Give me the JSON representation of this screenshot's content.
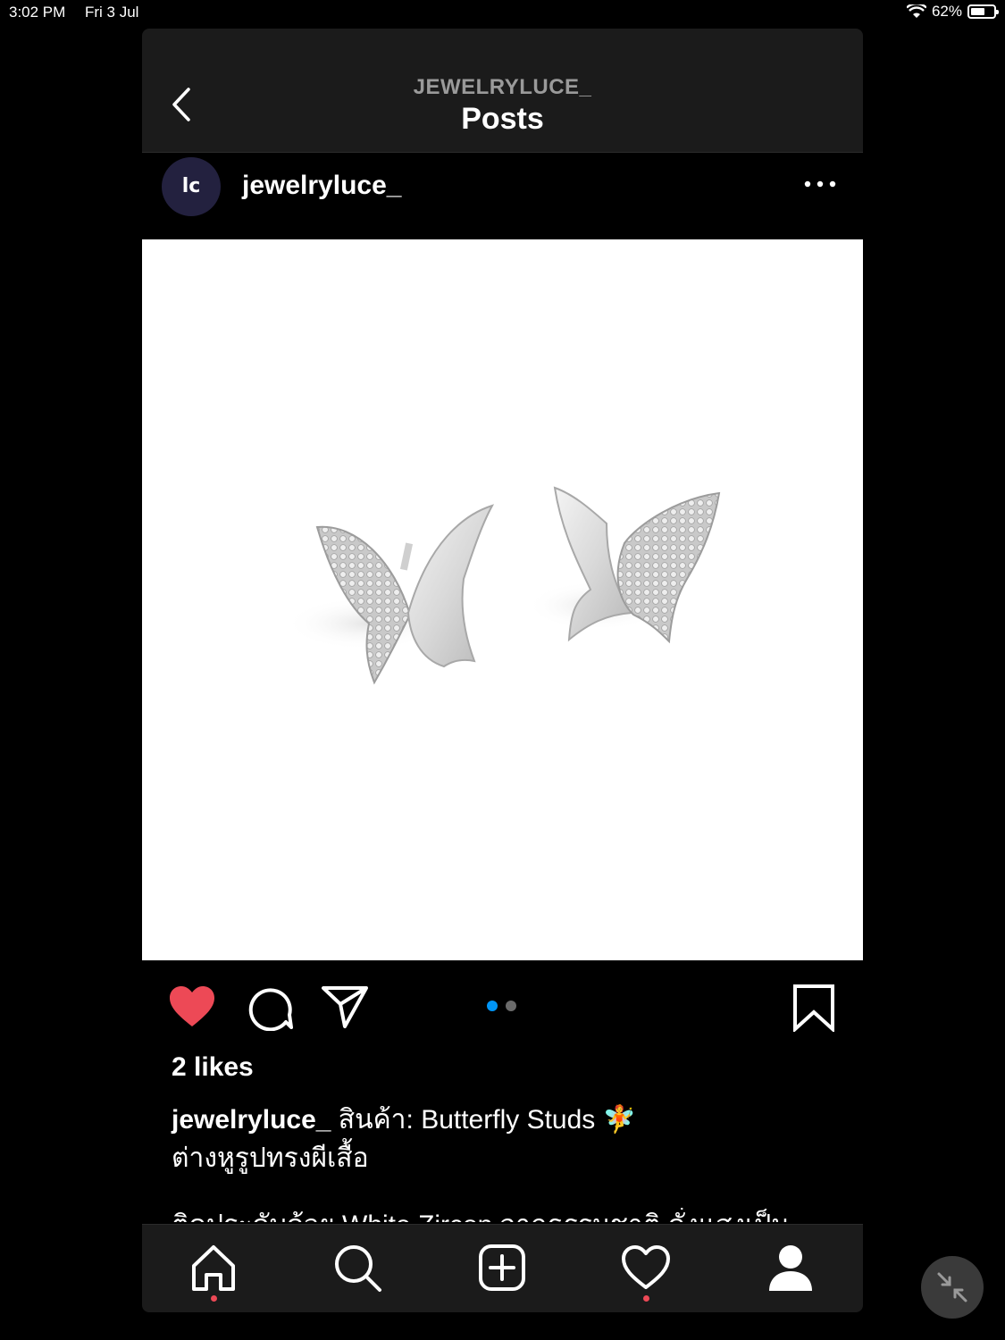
{
  "status_bar": {
    "time": "3:02 PM",
    "date": "Fri 3 Jul",
    "battery_percent": "62%",
    "battery_level": 0.62
  },
  "header": {
    "account": "JEWELRYLUCE_",
    "title": "Posts",
    "back_icon": "chevron-left-icon"
  },
  "post": {
    "username": "jewelryluce_",
    "avatar_text": "lc",
    "more_icon": "ellipsis-icon",
    "liked": true,
    "carousel": {
      "count": 2,
      "active": 0
    },
    "likes": "2 likes",
    "caption_author": "jewelryluce_",
    "caption_text": " สินค้า:  Butterfly Studs 🧚",
    "caption_line2": "ต่างหูรูปทรงผีเสื้อ",
    "caption_line3": "ติดประดับด้วย White Zircon จากธรรมชาติ ดั่งแสงเป็น"
  },
  "tabs": [
    "home",
    "search",
    "new-post",
    "activity",
    "profile"
  ],
  "colors": {
    "like": "#ed4956",
    "dot_active": "#0095f6",
    "dot_inactive": "#6b6b6b",
    "nav_bg": "#1b1b1b"
  }
}
